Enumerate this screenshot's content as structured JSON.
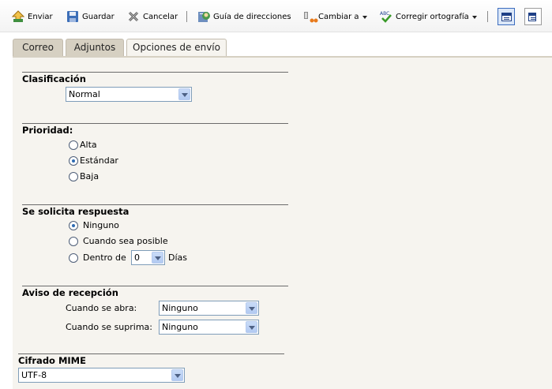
{
  "toolbar": {
    "send_label": "Enviar",
    "save_label": "Guardar",
    "cancel_label": "Cancelar",
    "address_book_label": "Guía de direcciones",
    "change_to_label": "Cambiar a",
    "spellcheck_label": "Corregir ortografía"
  },
  "tabs": [
    {
      "label": "Correo",
      "active": false
    },
    {
      "label": "Adjuntos",
      "active": false
    },
    {
      "label": "Opciones de envío",
      "active": true
    }
  ],
  "classification": {
    "title": "Clasificación",
    "selected": "Normal"
  },
  "priority": {
    "title": "Prioridad:",
    "options": [
      "Alta",
      "Estándar",
      "Baja"
    ],
    "selected": "Estándar"
  },
  "reply": {
    "title": "Se solicita respuesta",
    "options": [
      "Ninguno",
      "Cuando sea posible",
      "Dentro de"
    ],
    "selected": "Ninguno",
    "within_value": "0",
    "days_label": "Días"
  },
  "receipt": {
    "title": "Aviso de recepción",
    "opened_label": "Cuando se abra:",
    "opened_value": "Ninguno",
    "deleted_label": "Cuando se suprima:",
    "deleted_value": "Ninguno"
  },
  "mime": {
    "title": "Cifrado MIME",
    "selected": "UTF-8"
  },
  "colors": {
    "tab_bg": "#d6d0c2",
    "panel_bg": "#f6f4ef",
    "select_border": "#7f9db9"
  }
}
